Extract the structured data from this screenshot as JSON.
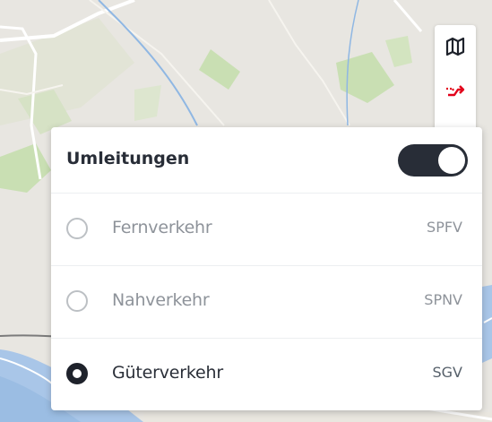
{
  "panel": {
    "title": "Umleitungen",
    "toggle_on": true,
    "options": [
      {
        "label": "Fernverkehr",
        "code": "SPFV",
        "selected": false
      },
      {
        "label": "Nahverkehr",
        "code": "SPNV",
        "selected": false
      },
      {
        "label": "Güterverkehr",
        "code": "SGV",
        "selected": true
      }
    ]
  },
  "controls": {
    "map_icon": "map-icon",
    "detour_icon": "detour-icon"
  },
  "colors": {
    "accent_red": "#e2001a",
    "dark": "#282d37",
    "map_green": "#c9dfb3",
    "water": "#a9c6e8"
  }
}
